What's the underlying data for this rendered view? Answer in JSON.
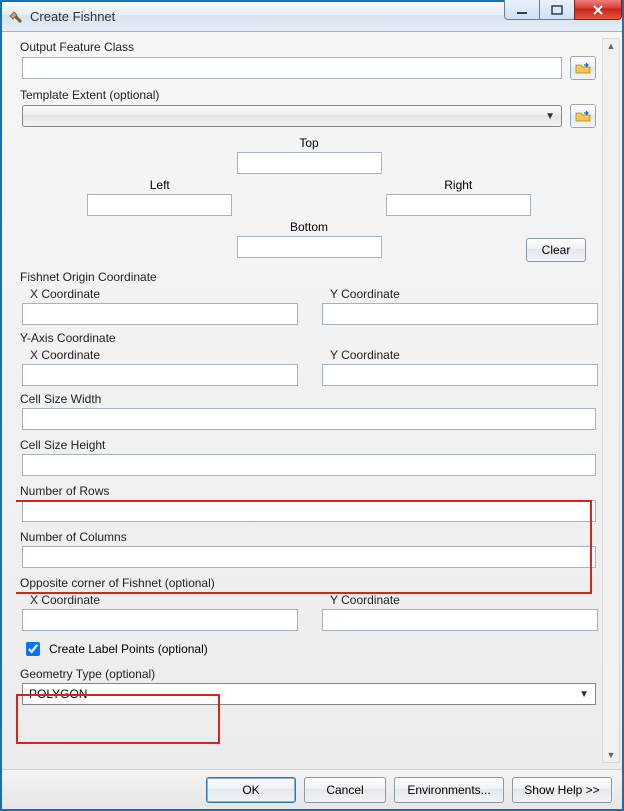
{
  "window": {
    "title": "Create Fishnet"
  },
  "labels": {
    "output_feature_class": "Output Feature Class",
    "template_extent": "Template Extent (optional)",
    "top": "Top",
    "left": "Left",
    "right": "Right",
    "bottom": "Bottom",
    "clear": "Clear",
    "fishnet_origin": "Fishnet Origin Coordinate",
    "y_axis_coord": "Y-Axis Coordinate",
    "x_coord": "X Coordinate",
    "y_coord": "Y Coordinate",
    "cell_w": "Cell Size Width",
    "cell_h": "Cell Size Height",
    "num_rows": "Number of Rows",
    "num_cols": "Number of Columns",
    "opp_corner": "Opposite corner of Fishnet (optional)",
    "create_labels": "Create Label Points (optional)",
    "geometry_type": "Geometry Type (optional)"
  },
  "values": {
    "output_feature_class": "",
    "template_extent": "",
    "extent_top": "",
    "extent_left": "",
    "extent_right": "",
    "extent_bottom": "",
    "origin_x": "",
    "origin_y": "",
    "yaxis_x": "",
    "yaxis_y": "",
    "cell_w": "",
    "cell_h": "",
    "num_rows": "",
    "num_cols": "",
    "opp_x": "",
    "opp_y": "",
    "create_labels_checked": true,
    "geometry_type": "POLYGON"
  },
  "buttons": {
    "ok": "OK",
    "cancel": "Cancel",
    "env": "Environments...",
    "help": "Show Help >>"
  }
}
